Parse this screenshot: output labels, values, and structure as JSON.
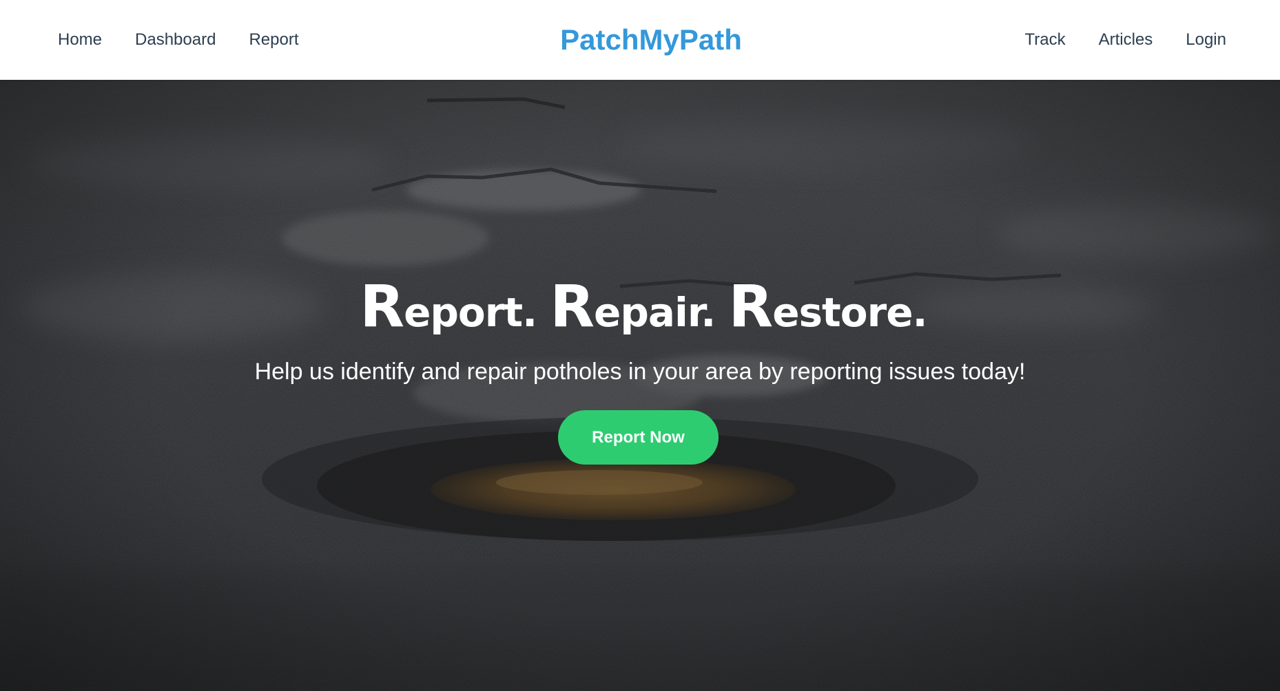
{
  "nav": {
    "left": [
      "Home",
      "Dashboard",
      "Report"
    ],
    "brand": "PatchMyPath",
    "right": [
      "Track",
      "Articles",
      "Login"
    ]
  },
  "hero": {
    "title_words": [
      {
        "cap": "R",
        "rest": "eport."
      },
      {
        "cap": "R",
        "rest": "epair."
      },
      {
        "cap": "R",
        "rest": "estore."
      }
    ],
    "subtitle": "Help us identify and repair potholes in your area by reporting issues today!",
    "cta_label": "Report Now",
    "background": "pothole-road-photo"
  },
  "colors": {
    "brand": "#3498db",
    "nav_text": "#2c3e50",
    "cta": "#2ecc71",
    "hero_text": "#ffffff"
  }
}
